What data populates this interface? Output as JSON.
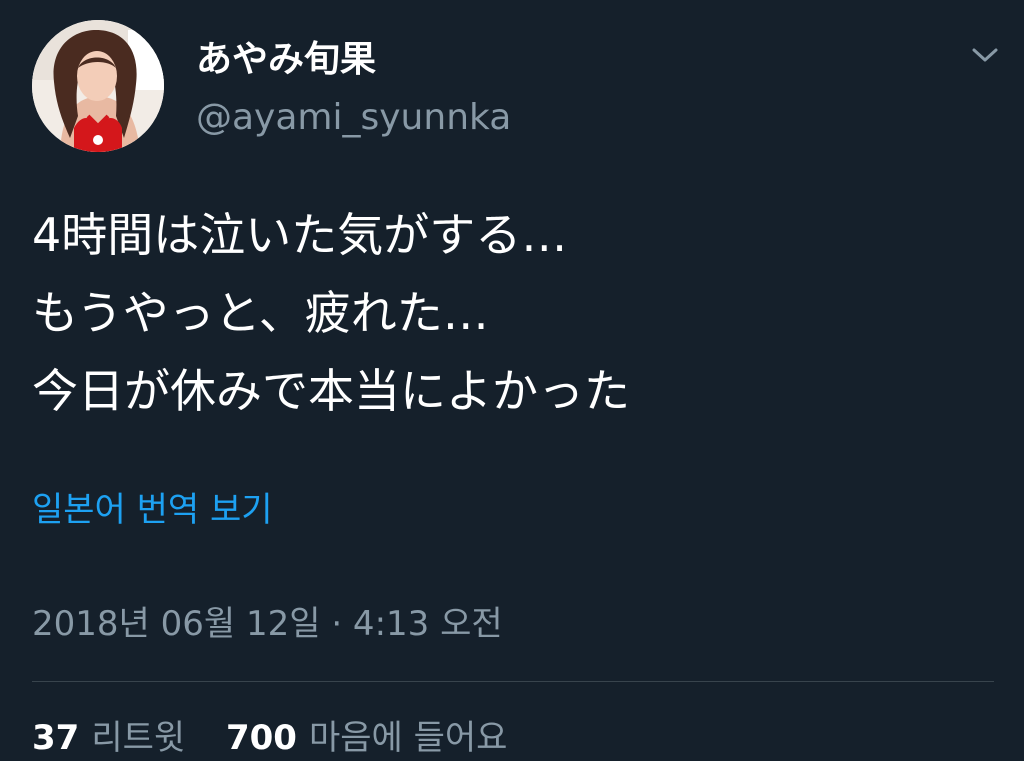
{
  "user": {
    "display_name": "あやみ旬果",
    "handle": "@ayami_syunnka"
  },
  "tweet": {
    "lines": [
      "4時間は泣いた気がする…",
      "もうやっと、疲れた…",
      "今日が休みで本当によかった"
    ],
    "translate_label": "일본어 번역 보기",
    "timestamp": "2018년 06월 12일 · 4:13 오전"
  },
  "stats": {
    "retweets": {
      "count": "37",
      "label": "리트윗"
    },
    "likes": {
      "count": "700",
      "label": "마음에 들어요"
    }
  },
  "icons": {
    "menu": "chevron-down-icon",
    "avatar": "profile-photo"
  },
  "colors": {
    "background": "#15202b",
    "text_primary": "#ffffff",
    "text_secondary": "#8899a6",
    "link": "#1da1f2",
    "divider": "#38444d"
  }
}
